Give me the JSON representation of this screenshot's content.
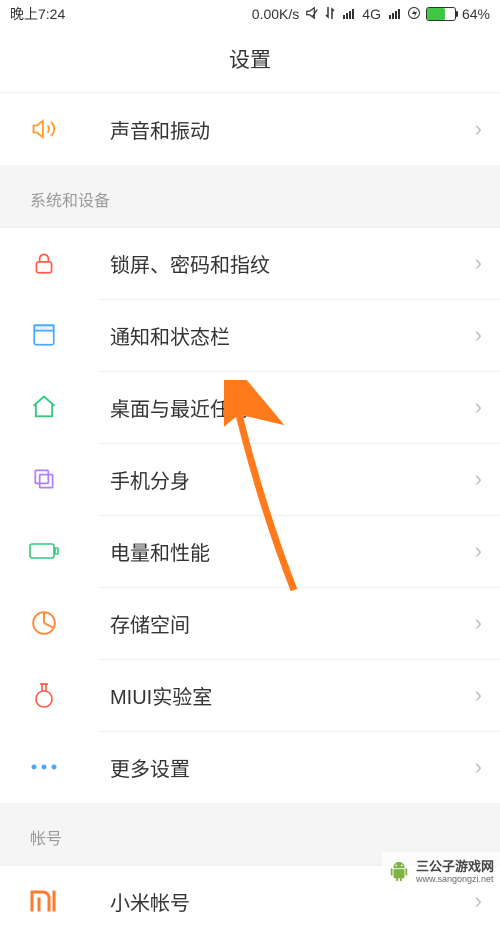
{
  "statusbar": {
    "time": "晚上7:24",
    "speed": "0.00K/s",
    "network": "4G",
    "battery_pct": "64%"
  },
  "header": {
    "title": "设置"
  },
  "top_row": {
    "label": "声音和振动"
  },
  "sections": [
    {
      "title": "系统和设备"
    },
    {
      "title": "帐号"
    }
  ],
  "system_items": [
    {
      "label": "锁屏、密码和指纹"
    },
    {
      "label": "通知和状态栏"
    },
    {
      "label": "桌面与最近任务"
    },
    {
      "label": "手机分身"
    },
    {
      "label": "电量和性能"
    },
    {
      "label": "存储空间"
    },
    {
      "label": "MIUI实验室"
    },
    {
      "label": "更多设置"
    }
  ],
  "account_items": [
    {
      "label": "小米帐号"
    }
  ],
  "watermark": {
    "brand": "三公子游戏网",
    "url": "www.sangongzi.net"
  }
}
